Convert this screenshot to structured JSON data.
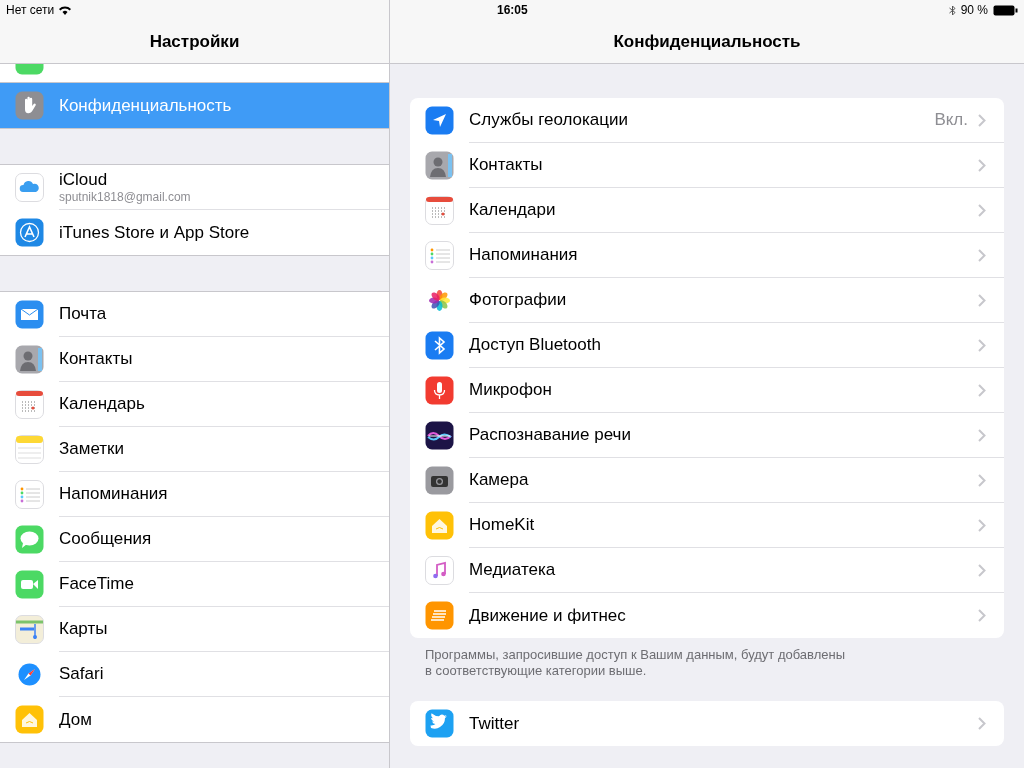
{
  "status_bar": {
    "carrier": "Нет сети",
    "time": "16:05",
    "battery": "90 %"
  },
  "sidebar": {
    "title": "Настройки",
    "groups": [
      {
        "items": [
          {
            "selected": false
          },
          {
            "label": "Конфиденциальность",
            "selected": true
          }
        ]
      },
      {
        "items": [
          {
            "label": "iCloud",
            "subtitle": "sputnik1818@gmail.com",
            "selected": false
          },
          {
            "label": "iTunes Store и App Store",
            "selected": false
          }
        ]
      },
      {
        "items": [
          {
            "label": "Почта",
            "selected": false
          },
          {
            "label": "Контакты",
            "selected": false
          },
          {
            "label": "Календарь",
            "selected": false
          },
          {
            "label": "Заметки",
            "selected": false
          },
          {
            "label": "Напоминания",
            "selected": false
          },
          {
            "label": "Сообщения",
            "selected": false
          },
          {
            "label": "FaceTime",
            "selected": false
          },
          {
            "label": "Карты",
            "selected": false
          },
          {
            "label": "Safari",
            "selected": false
          },
          {
            "label": "Дом",
            "selected": false
          }
        ]
      }
    ]
  },
  "detail": {
    "title": "Конфиденциальность",
    "groups": [
      {
        "items": [
          {
            "label": "Службы геолокации",
            "value": "Вкл."
          },
          {
            "label": "Контакты"
          },
          {
            "label": "Календари"
          },
          {
            "label": "Напоминания"
          },
          {
            "label": "Фотографии"
          },
          {
            "label": "Доступ Bluetooth"
          },
          {
            "label": "Микрофон"
          },
          {
            "label": "Распознавание речи"
          },
          {
            "label": "Камера"
          },
          {
            "label": "HomeKit"
          },
          {
            "label": "Медиатека"
          },
          {
            "label": "Движение и фитнес"
          }
        ],
        "footer": "Программы, запросившие доступ к Вашим данным, будут добавлены в соответствующие категории выше."
      },
      {
        "items": [
          {
            "label": "Twitter"
          }
        ]
      }
    ]
  }
}
